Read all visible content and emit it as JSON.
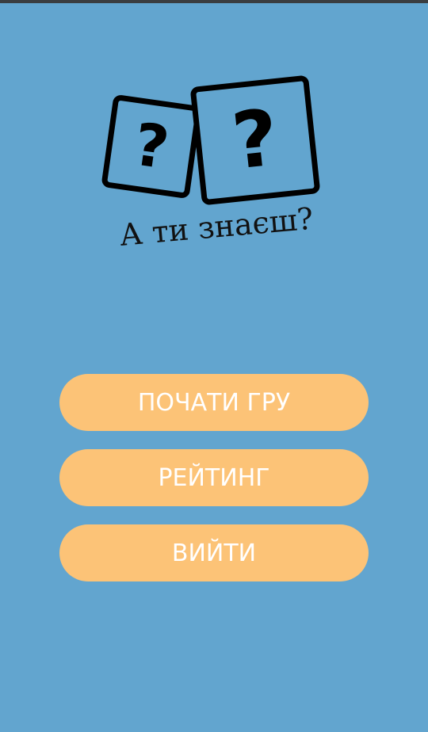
{
  "logo": {
    "left_card_glyph": "?",
    "right_card_glyph": "?",
    "tagline": "А ти знаєш?"
  },
  "menu": {
    "start_game_label": "ПОЧАТИ ГРУ",
    "rating_label": "РЕЙТИНГ",
    "exit_label": "ВИЙТИ"
  },
  "colors": {
    "background": "#62a5cf",
    "button": "#fcc377",
    "button_text": "#ffffff",
    "logo_ink": "#000000"
  }
}
